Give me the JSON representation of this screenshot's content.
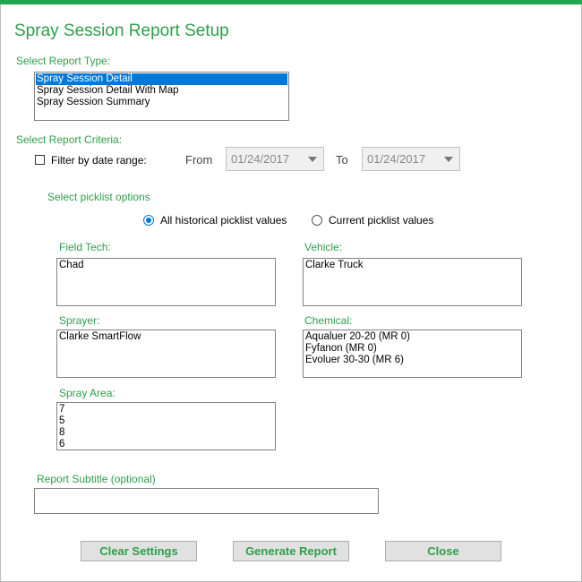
{
  "window": {
    "title": "Spray Session Report Setup",
    "accent_color": "#21a84d"
  },
  "report_type": {
    "label": "Select Report Type:",
    "options": [
      "Spray Session Detail",
      "Spray Session Detail With Map",
      "Spray Session Summary"
    ],
    "selected": "Spray Session Detail"
  },
  "criteria": {
    "label": "Select Report Criteria:",
    "filter_by_date": {
      "label": "Filter by date range:",
      "checked": false
    },
    "from_label": "From",
    "from_value": "01/24/2017",
    "to_label": "To",
    "to_value": "01/24/2017"
  },
  "picklist": {
    "label": "Select picklist options",
    "all_historical": {
      "label": "All historical picklist values",
      "selected": true
    },
    "current": {
      "label": "Current picklist values",
      "selected": false
    }
  },
  "field_tech": {
    "label": "Field Tech:",
    "items": [
      "Chad"
    ]
  },
  "vehicle": {
    "label": "Vehicle:",
    "items": [
      "Clarke Truck"
    ]
  },
  "sprayer": {
    "label": "Sprayer:",
    "items": [
      "Clarke SmartFlow"
    ]
  },
  "chemical": {
    "label": "Chemical:",
    "items": [
      "Aqualuer 20-20 (MR 0)",
      "Fyfanon (MR 0)",
      "Evoluer 30-30 (MR 6)"
    ]
  },
  "spray_area": {
    "label": "Spray Area:",
    "items": [
      "7",
      "5",
      "8",
      "6"
    ]
  },
  "subtitle": {
    "label": "Report Subtitle (optional)",
    "value": ""
  },
  "buttons": {
    "clear": "Clear Settings",
    "generate": "Generate Report",
    "close": "Close"
  }
}
